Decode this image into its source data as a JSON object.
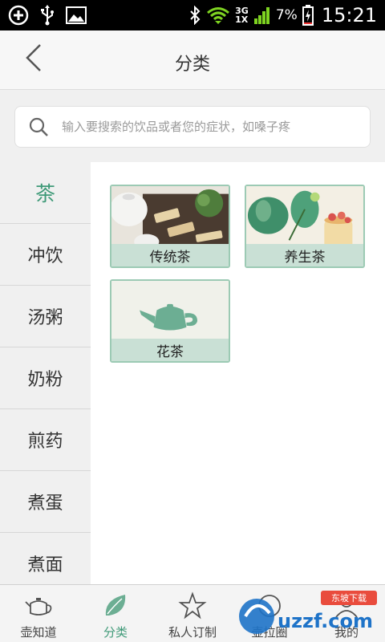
{
  "status_bar": {
    "network_top": "3G",
    "network_bottom": "1X",
    "battery": "7%",
    "time": "15:21"
  },
  "header": {
    "title": "分类"
  },
  "search": {
    "placeholder": "输入要搜索的饮品或者您的症状，如嗓子疼"
  },
  "sidebar": {
    "items": [
      {
        "label": "茶",
        "active": true
      },
      {
        "label": "冲饮"
      },
      {
        "label": "汤粥"
      },
      {
        "label": "奶粉"
      },
      {
        "label": "煎药"
      },
      {
        "label": "煮蛋"
      },
      {
        "label": "煮面"
      }
    ]
  },
  "categories": [
    {
      "label": "传统茶"
    },
    {
      "label": "养生茶"
    },
    {
      "label": "花茶"
    }
  ],
  "bottom_nav": {
    "items": [
      {
        "label": "壶知道",
        "icon": "teapot-icon"
      },
      {
        "label": "分类",
        "icon": "leaf-icon",
        "active": true
      },
      {
        "label": "私人订制",
        "icon": "star-icon"
      },
      {
        "label": "壶拉圈",
        "icon": "circle-icon"
      },
      {
        "label": "我的",
        "icon": "user-icon"
      }
    ]
  },
  "watermark": {
    "text": "uzzf.com",
    "badge": "东坡下载"
  },
  "colors": {
    "accent": "#3f9a78",
    "card_border": "#9ccab4",
    "card_band": "#c9e0d5"
  }
}
